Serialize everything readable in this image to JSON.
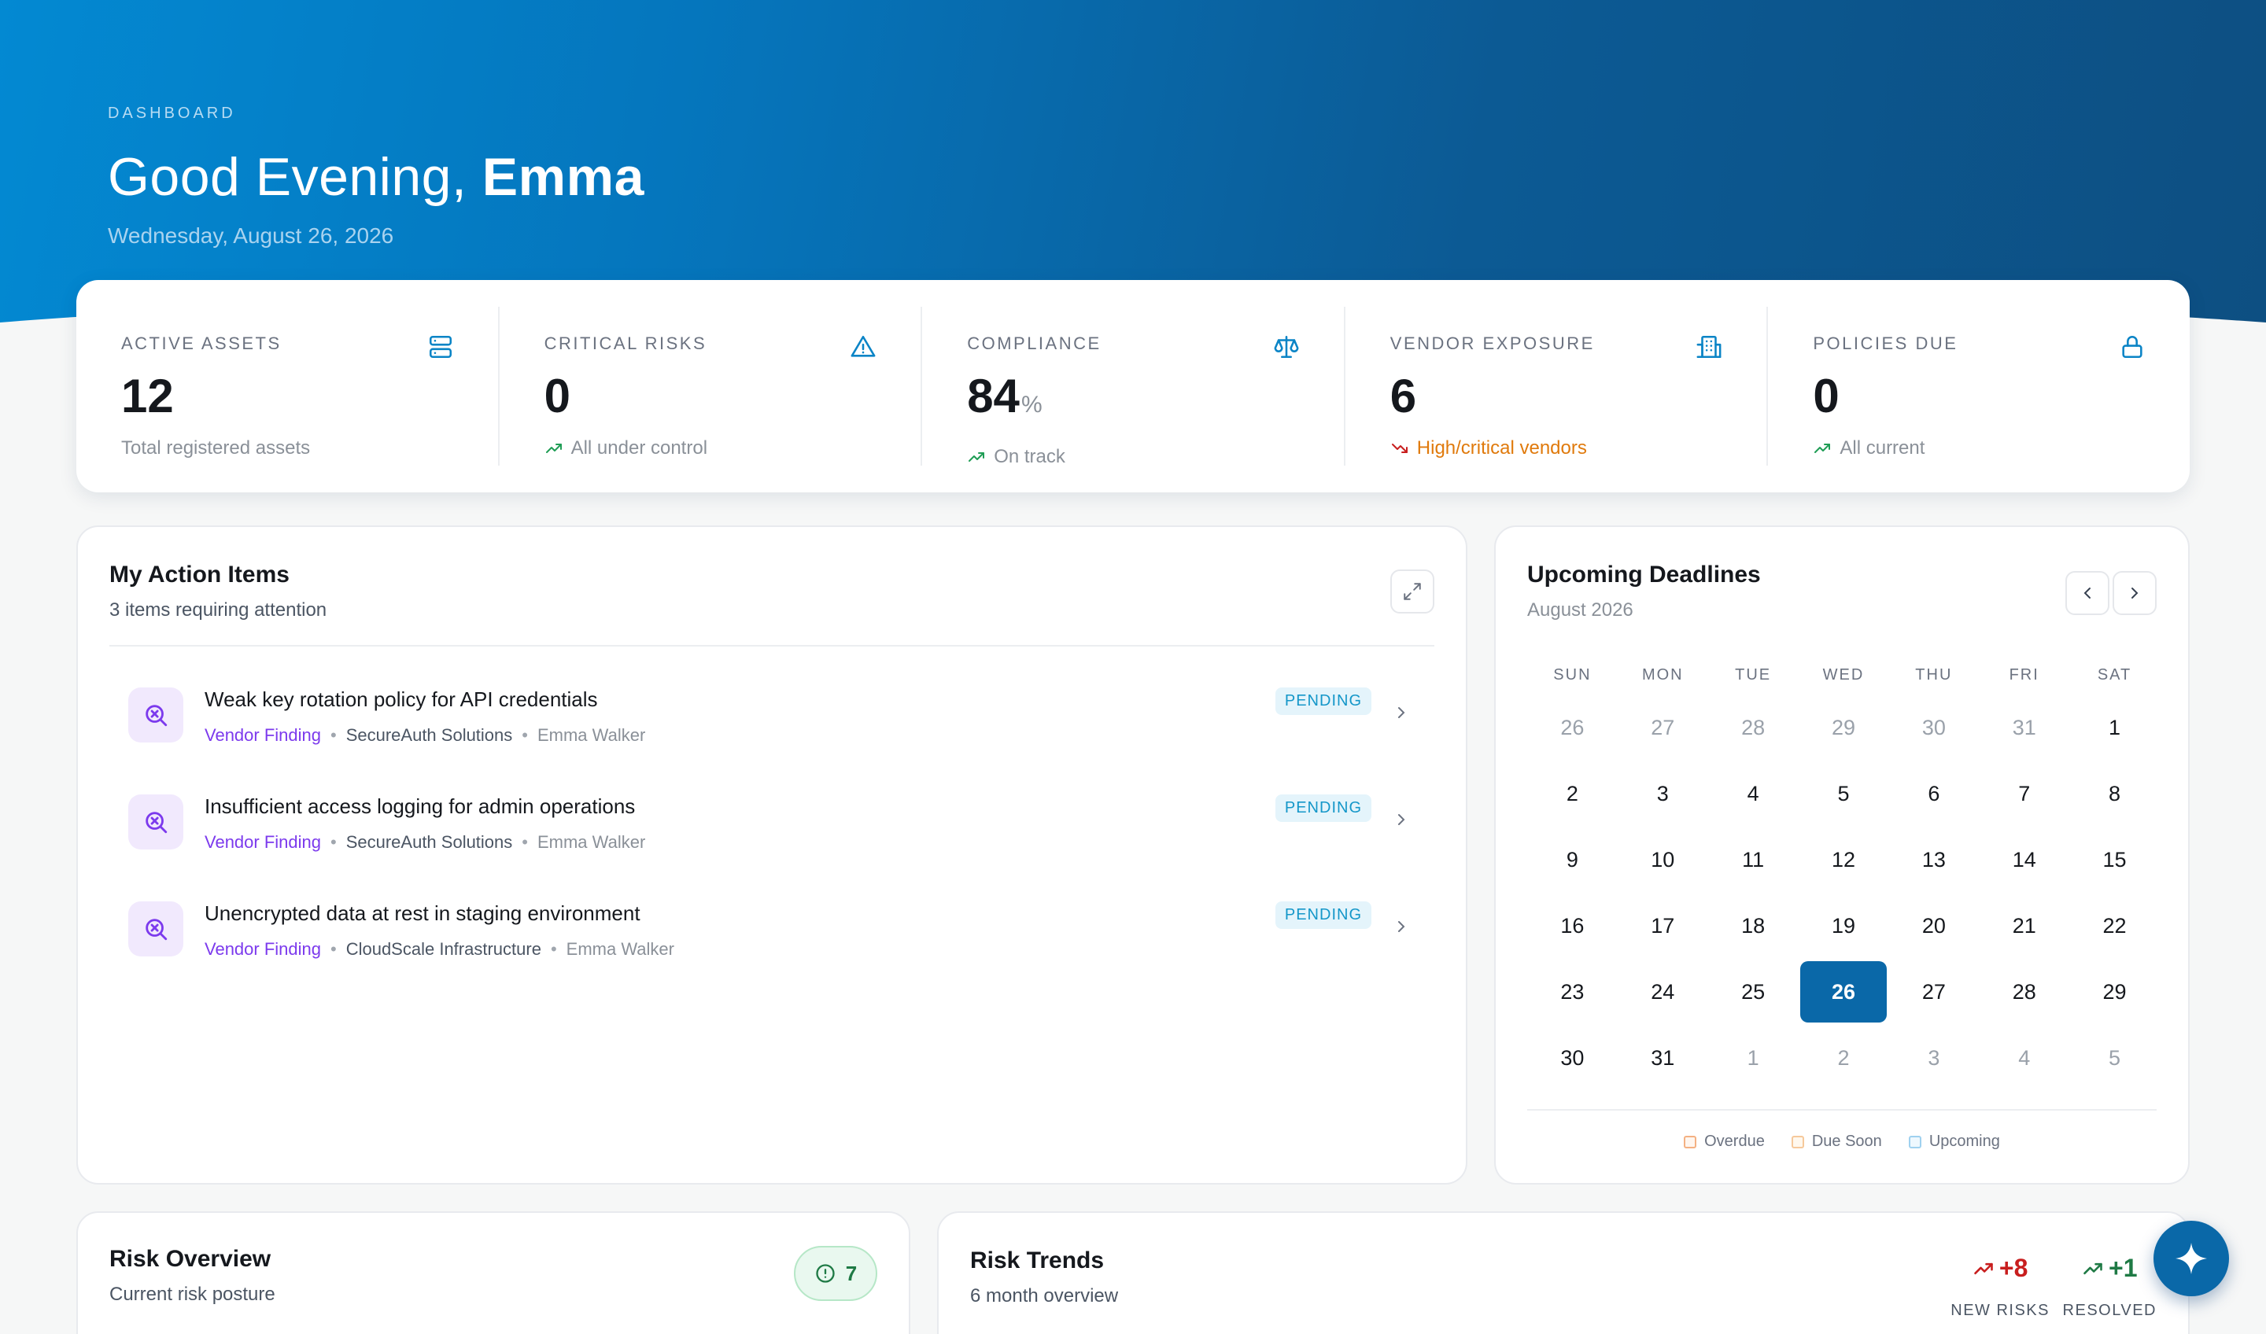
{
  "hero": {
    "eyebrow": "DASHBOARD",
    "greeting": "Good Evening,",
    "name": "Emma",
    "date": "Wednesday, August 26, 2026"
  },
  "stats": [
    {
      "label": "ACTIVE ASSETS",
      "value": "12",
      "unit": "",
      "sub": "Total registered assets",
      "icon": "server-icon"
    },
    {
      "label": "CRITICAL RISKS",
      "value": "0",
      "unit": "",
      "sub": "All under control",
      "icon": "warning-icon"
    },
    {
      "label": "COMPLIANCE",
      "value": "84",
      "unit": "%",
      "sub": "On track",
      "icon": "scale-icon"
    },
    {
      "label": "VENDOR EXPOSURE",
      "value": "6",
      "unit": "",
      "sub": "High/critical vendors",
      "icon": "building-icon"
    },
    {
      "label": "POLICIES DUE",
      "value": "0",
      "unit": "",
      "sub": "All current",
      "icon": "lock-icon"
    }
  ],
  "actions": {
    "title": "My Action Items",
    "subtitle": "3 items requiring attention",
    "items": [
      {
        "title": "Weak key rotation policy for API credentials",
        "category": "Vendor Finding",
        "vendor": "SecureAuth Solutions",
        "owner": "Emma Walker",
        "status": "PENDING"
      },
      {
        "title": "Insufficient access logging for admin operations",
        "category": "Vendor Finding",
        "vendor": "SecureAuth Solutions",
        "owner": "Emma Walker",
        "status": "PENDING"
      },
      {
        "title": "Unencrypted data at rest in staging environment",
        "category": "Vendor Finding",
        "vendor": "CloudScale Infrastructure",
        "owner": "Emma Walker",
        "status": "PENDING"
      }
    ]
  },
  "calendar": {
    "title": "Upcoming Deadlines",
    "month": "August 2026",
    "weekdays": [
      "SUN",
      "MON",
      "TUE",
      "WED",
      "THU",
      "FRI",
      "SAT"
    ],
    "days": [
      {
        "d": "26",
        "muted": true
      },
      {
        "d": "27",
        "muted": true
      },
      {
        "d": "28",
        "muted": true
      },
      {
        "d": "29",
        "muted": true
      },
      {
        "d": "30",
        "muted": true
      },
      {
        "d": "31",
        "muted": true
      },
      {
        "d": "1"
      },
      {
        "d": "2"
      },
      {
        "d": "3"
      },
      {
        "d": "4"
      },
      {
        "d": "5"
      },
      {
        "d": "6"
      },
      {
        "d": "7"
      },
      {
        "d": "8"
      },
      {
        "d": "9"
      },
      {
        "d": "10"
      },
      {
        "d": "11"
      },
      {
        "d": "12"
      },
      {
        "d": "13"
      },
      {
        "d": "14"
      },
      {
        "d": "15"
      },
      {
        "d": "16"
      },
      {
        "d": "17"
      },
      {
        "d": "18"
      },
      {
        "d": "19"
      },
      {
        "d": "20"
      },
      {
        "d": "21"
      },
      {
        "d": "22"
      },
      {
        "d": "23"
      },
      {
        "d": "24"
      },
      {
        "d": "25"
      },
      {
        "d": "26",
        "today": true
      },
      {
        "d": "27"
      },
      {
        "d": "28"
      },
      {
        "d": "29"
      },
      {
        "d": "30"
      },
      {
        "d": "31"
      },
      {
        "d": "1",
        "muted": true
      },
      {
        "d": "2",
        "muted": true
      },
      {
        "d": "3",
        "muted": true
      },
      {
        "d": "4",
        "muted": true
      },
      {
        "d": "5",
        "muted": true
      }
    ],
    "legend": [
      {
        "label": "Overdue",
        "color": "#f4b183"
      },
      {
        "label": "Due Soon",
        "color": "#f6c99b"
      },
      {
        "label": "Upcoming",
        "color": "#9fd1ef"
      }
    ]
  },
  "risk_overview": {
    "title": "Risk Overview",
    "subtitle": "Current risk posture",
    "count": "7"
  },
  "risk_trends": {
    "title": "Risk Trends",
    "subtitle": "6 month overview",
    "new_value": "+8",
    "new_label": "NEW RISKS",
    "resolved_value": "+1",
    "resolved_label": "RESOLVED"
  },
  "colors": {
    "accent": "#0a68a8",
    "purple": "#7c3aed",
    "warning": "#e07a0c",
    "success": "#1f7a45",
    "danger": "#c81e1e"
  }
}
